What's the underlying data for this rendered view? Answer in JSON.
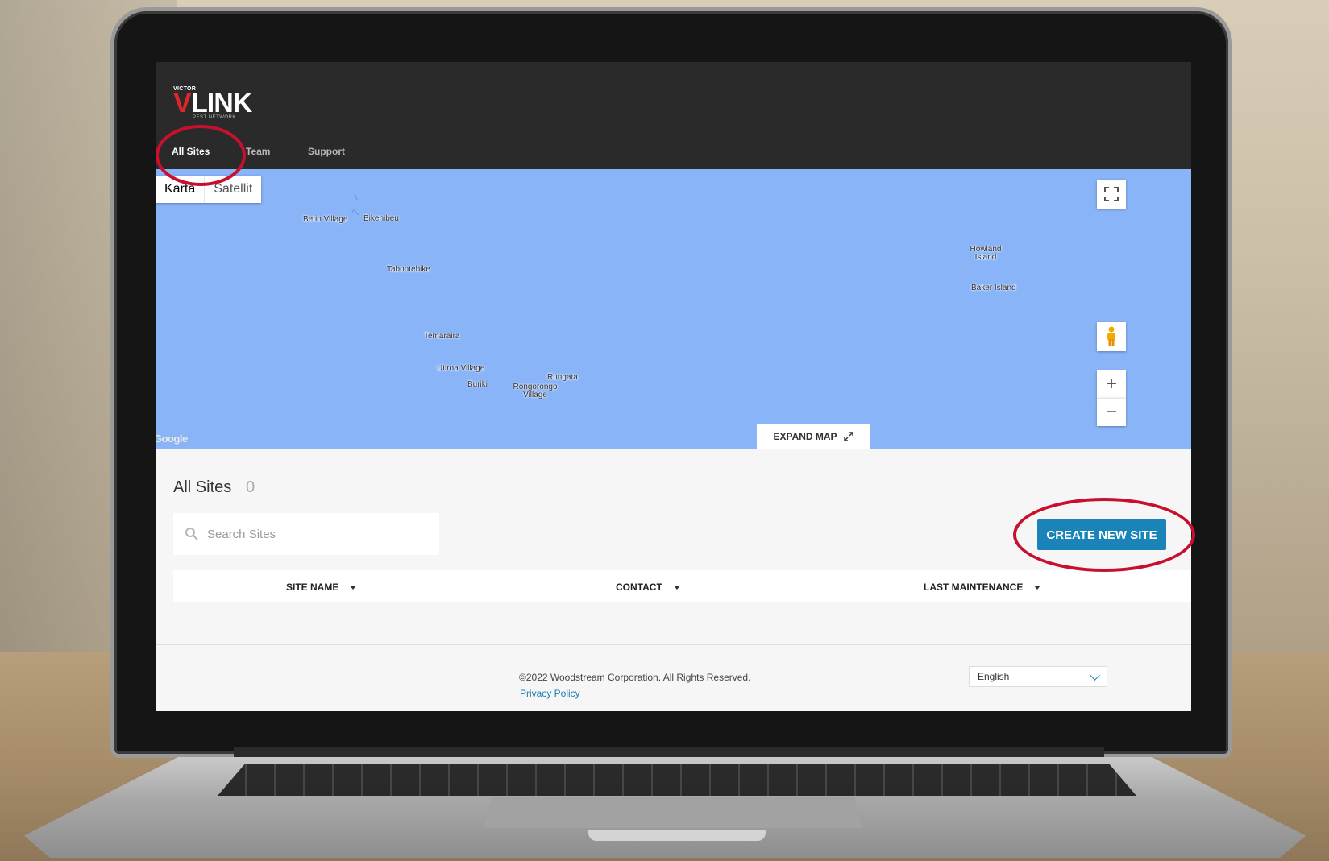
{
  "logo": {
    "victor": "VICTOR",
    "v": "V",
    "link": "LINK",
    "sub": "PEST NETWORK"
  },
  "nav": {
    "items": [
      "All Sites",
      "Team",
      "Support"
    ],
    "active": "All Sites"
  },
  "map": {
    "types": [
      "Karta",
      "Satellit"
    ],
    "selected_type": "Karta",
    "places": [
      "Betio Village",
      "Bikenibeu",
      "Tabontebike",
      "Temaraira",
      "Utiroa Village",
      "Buriki",
      "Rungata",
      "Rongorongo Village",
      "Howland Island",
      "Baker Island"
    ],
    "google": "Google",
    "expand_label": "EXPAND MAP",
    "zoom_in": "+",
    "zoom_out": "−",
    "water_color": "#8ab4f8"
  },
  "sites": {
    "title": "All Sites",
    "count": "0",
    "search_placeholder": "Search Sites",
    "create_label": "CREATE NEW SITE",
    "columns": [
      "SITE NAME",
      "CONTACT",
      "LAST MAINTENANCE"
    ]
  },
  "footer": {
    "copyright": "©2022 Woodstream Corporation. All Rights Reserved.",
    "privacy": "Privacy Policy",
    "language": "English"
  },
  "colors": {
    "accent": "#1a84b8",
    "annotation": "#c8102e",
    "topbar": "#2a2a2a"
  }
}
